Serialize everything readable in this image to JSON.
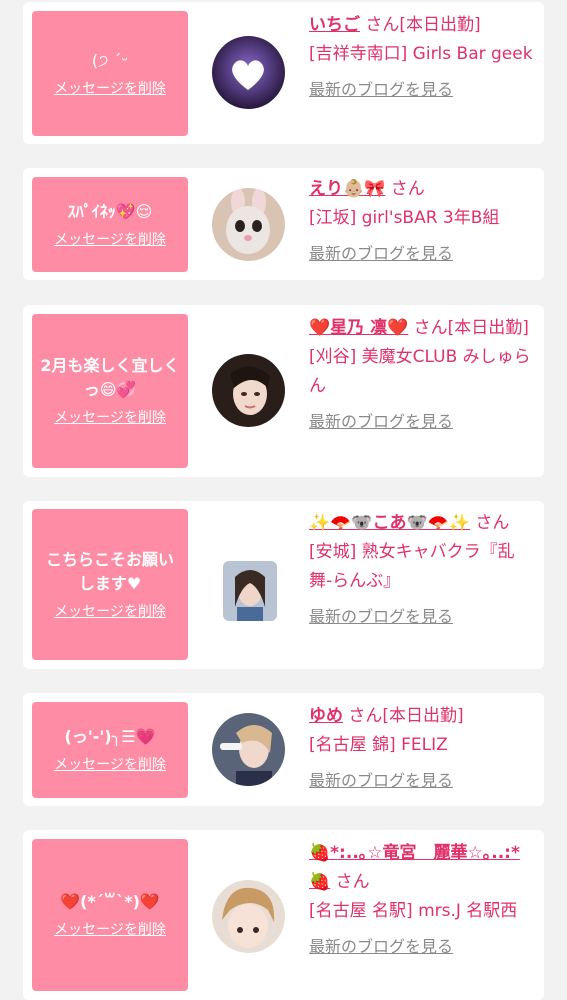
{
  "common": {
    "delete_label": "メッセージを削除",
    "blog_label": "最新のブログを見る",
    "san": "さん"
  },
  "colors": {
    "accent": "#e0316a",
    "message_bg": "#fe8ca4",
    "link_gray": "#8a8a8a",
    "page_bg": "#f2f2f2"
  },
  "cards": [
    {
      "message": "(੭ ˊᵕ",
      "name": "いちご",
      "status": "[本日出勤]",
      "shop": "[吉祥寺南口] Girls Bar geek",
      "avatar": "heart-avatar"
    },
    {
      "message": "ｽﾊﾟｲﾈｯ💖😌",
      "name": "えり👶🏼🎀",
      "status": "",
      "shop": "[江坂] girl'sBAR 3年B組",
      "avatar": "bunny-avatar"
    },
    {
      "message": "2月も楽しく宜しくっ😄💞",
      "name": "❤️星乃 凛❤️",
      "status": "[本日出勤]",
      "shop": "[刈谷] 美魔女CLUB みしゅらん",
      "avatar": "woman-avatar"
    },
    {
      "message": "こちらこそお願いします♥",
      "name": "✨🪭🐨こあ🐨🪭✨",
      "status": "",
      "shop": "[安城] 熟女キャバクラ『乱舞-らんぶ』",
      "avatar": "photo-avatar"
    },
    {
      "message": "(っ'-')╮☰💗",
      "name": "ゆめ",
      "status": "[本日出勤]",
      "shop": "[名古屋 錦] FELIZ",
      "avatar": "peace-avatar"
    },
    {
      "message": "❤️(*´꒳`*)❤️",
      "name": "🍓*:..｡☆竜宮　麗華☆｡..:*🍓",
      "status": "",
      "shop": "[名古屋 名駅] mrs.J 名駅西",
      "avatar": "blonde-avatar"
    }
  ]
}
